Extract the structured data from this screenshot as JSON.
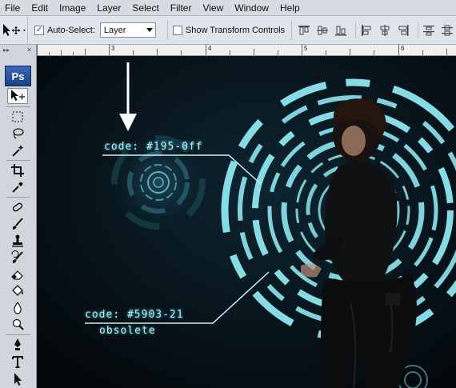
{
  "menubar": {
    "items": [
      "File",
      "Edit",
      "Image",
      "Layer",
      "Select",
      "Filter",
      "View",
      "Window",
      "Help"
    ]
  },
  "options": {
    "auto_select_label": "Auto-Select:",
    "auto_select_checked": true,
    "layer_value": "Layer",
    "show_transform_label": "Show Transform Controls",
    "show_transform_checked": false
  },
  "ruler": {
    "labels": [
      "3",
      "4",
      "5",
      "6"
    ]
  },
  "toolbar": {
    "logo": "Ps"
  },
  "canvas": {
    "code_top": "code: #195-0ff",
    "code_bottom": "code: #5903-21",
    "obsolete": "obsolete"
  },
  "colors": {
    "hud_cyan": "#8ee6ef",
    "canvas_bg": "#06121a"
  }
}
